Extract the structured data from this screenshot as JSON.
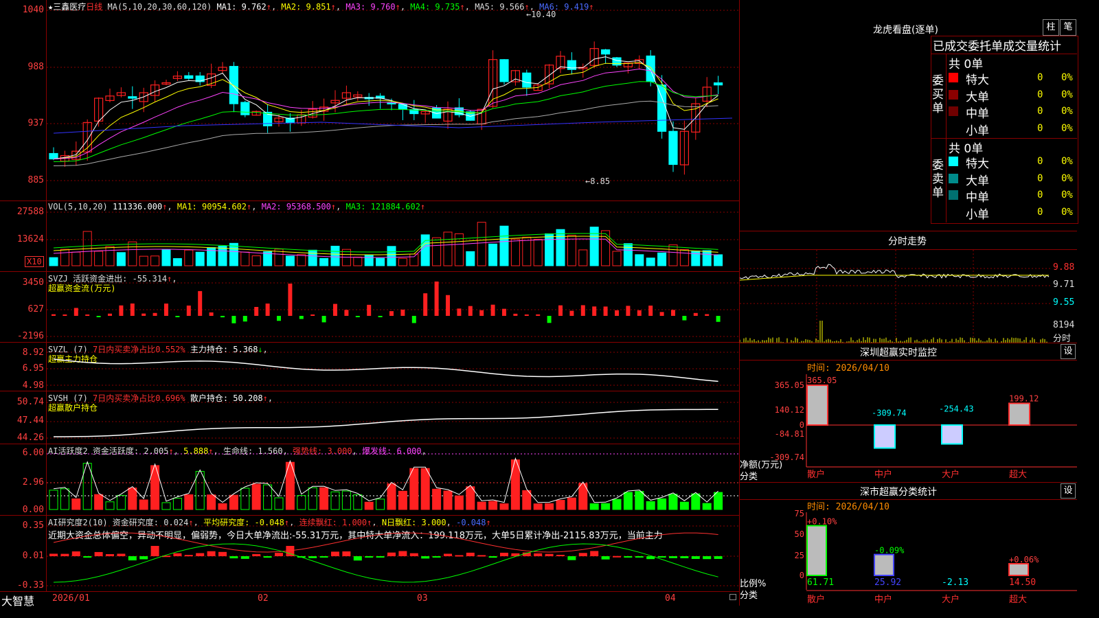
{
  "stock": {
    "name": "三鑫医疗",
    "period": "日线"
  },
  "ma_header": {
    "prefix": "MA(5,10,20,30,60,120)",
    "ma1": "MA1: 9.762",
    "ma2": "MA2: 9.851",
    "ma3": "MA3: 9.760",
    "ma4": "MA4: 9.735",
    "ma5": "MA5: 9.566",
    "ma6": "MA6: 9.419"
  },
  "price_axis": [
    "1040",
    "988",
    "937",
    "885"
  ],
  "price_high_label": "10.40",
  "price_low_label": "8.85",
  "vol": {
    "header": "VOL(5,10,20)",
    "value": "111336.000",
    "ma1": "MA1: 90954.602",
    "ma2": "MA2: 95368.500",
    "ma3": "MA3: 121884.602",
    "axis": [
      "27588",
      "13624"
    ],
    "unit": "X10"
  },
  "svzj": {
    "header": "SVZJ  活跃资金进出: -55.314",
    "title": "超赢资金流(万元)",
    "axis": [
      "3450",
      "627",
      "-2196"
    ]
  },
  "svzl": {
    "header": "SVZL (7)",
    "ratio": "7日内买卖净占比0.552%",
    "hold": "主力持仓: 5.368",
    "title": "超赢主力持仓",
    "axis": [
      "8.92",
      "6.95",
      "4.98"
    ]
  },
  "svsh": {
    "header": "SVSH (7)",
    "ratio": "7日内买卖净占比0.696%",
    "hold": "散户持仓: 50.208",
    "title": "超赢散户持仓",
    "axis": [
      "50.74",
      "47.44",
      "44.26"
    ]
  },
  "ai_active": {
    "header": "AI活跃度2 资金活跃度: 2.005",
    "v2": "5.888",
    "life": "生命线: 1.560",
    "strong": "强势线: 3.000",
    "burst": "爆发线: 6.000",
    "axis": [
      "6.00",
      "2.96",
      "0.00"
    ]
  },
  "ai_research": {
    "header": "AI研究度2(10) 资金研究度: 0.024",
    "avg": "平均研究度: -0.048",
    "red": "连续飘红: 1.000",
    "nred": "N日飘红: 3.000",
    "last": "-0.048",
    "axis": [
      "0.35",
      "0.01",
      "-0.33"
    ],
    "summary": "近期大资金总体偏空，异动不明显，偏弱势，今日大单净流出:-55.31万元，其中特大单净流入：199.118万元，大单5日累计净出-2115.83万元，当前主力"
  },
  "x_axis": {
    "logo": "大智慧",
    "labels": [
      "2026/01",
      "02",
      "03",
      "04"
    ]
  },
  "lhb": {
    "title": "龙虎看盘(逐单)",
    "btn1": "柱",
    "btn2": "笔",
    "subtitle": "已成交委托单成交量统计",
    "buy": {
      "label": "委买单",
      "total": "共 0单",
      "rows": [
        {
          "name": "特大",
          "v": "0",
          "p": "0%",
          "color": "#ff0000"
        },
        {
          "name": "大单",
          "v": "0",
          "p": "0%",
          "color": "#8b0000"
        },
        {
          "name": "中单",
          "v": "0",
          "p": "0%",
          "color": "#700000"
        },
        {
          "name": "小单",
          "v": "0",
          "p": "0%",
          "color": "#000"
        }
      ]
    },
    "sell": {
      "label": "委卖单",
      "total": "共 0单",
      "rows": [
        {
          "name": "特大",
          "v": "0",
          "p": "0%",
          "color": "#00ffff"
        },
        {
          "name": "大单",
          "v": "0",
          "p": "0%",
          "color": "#008b8b"
        },
        {
          "name": "中单",
          "v": "0",
          "p": "0%",
          "color": "#007070"
        },
        {
          "name": "小单",
          "v": "0",
          "p": "0%",
          "color": "#000"
        }
      ]
    }
  },
  "intraday": {
    "title": "分时走势",
    "axis": [
      "9.88",
      "9.71",
      "9.55"
    ],
    "vol_label": "8194",
    "vol_unit": "分时"
  },
  "monitor": {
    "title": "深圳超赢实时监控",
    "btn": "设",
    "time": "时间: 2026/04/10",
    "axis": [
      "365.05",
      "140.12",
      "0",
      "-84.81",
      "-309.74"
    ],
    "ylabel": "净额(万元)",
    "xlabel": "分类",
    "categories": [
      "散户",
      "中户",
      "大户",
      "超大"
    ],
    "values": [
      365.05,
      -309.74,
      -254.43,
      199.12
    ],
    "value_labels": [
      "365.05",
      "-309.74",
      "-254.43",
      "199.12"
    ]
  },
  "classify": {
    "title": "深市超赢分类统计",
    "btn": "设",
    "time": "时间: 2026/04/10",
    "axis": [
      "75",
      "50",
      "25",
      "0"
    ],
    "ylabel": "比例%",
    "xlabel": "分类",
    "categories": [
      "散户",
      "中户",
      "大户",
      "超大"
    ],
    "pct_labels": [
      "+0.10%",
      "-0.09%",
      "",
      "+0.06%"
    ],
    "values": [
      61.71,
      25.92,
      -2.13,
      14.5
    ],
    "value_labels": [
      "61.71",
      "25.92",
      "-2.13",
      "14.50"
    ]
  },
  "colors": {
    "up": "#ff2020",
    "down": "#00ffff",
    "grid": "#8a0000",
    "ma1": "#ffffff",
    "ma2": "#ffff00",
    "ma3": "#ff44ff",
    "ma4": "#00ff00",
    "ma5": "#aaaaaa",
    "ma6": "#3333ff"
  }
}
